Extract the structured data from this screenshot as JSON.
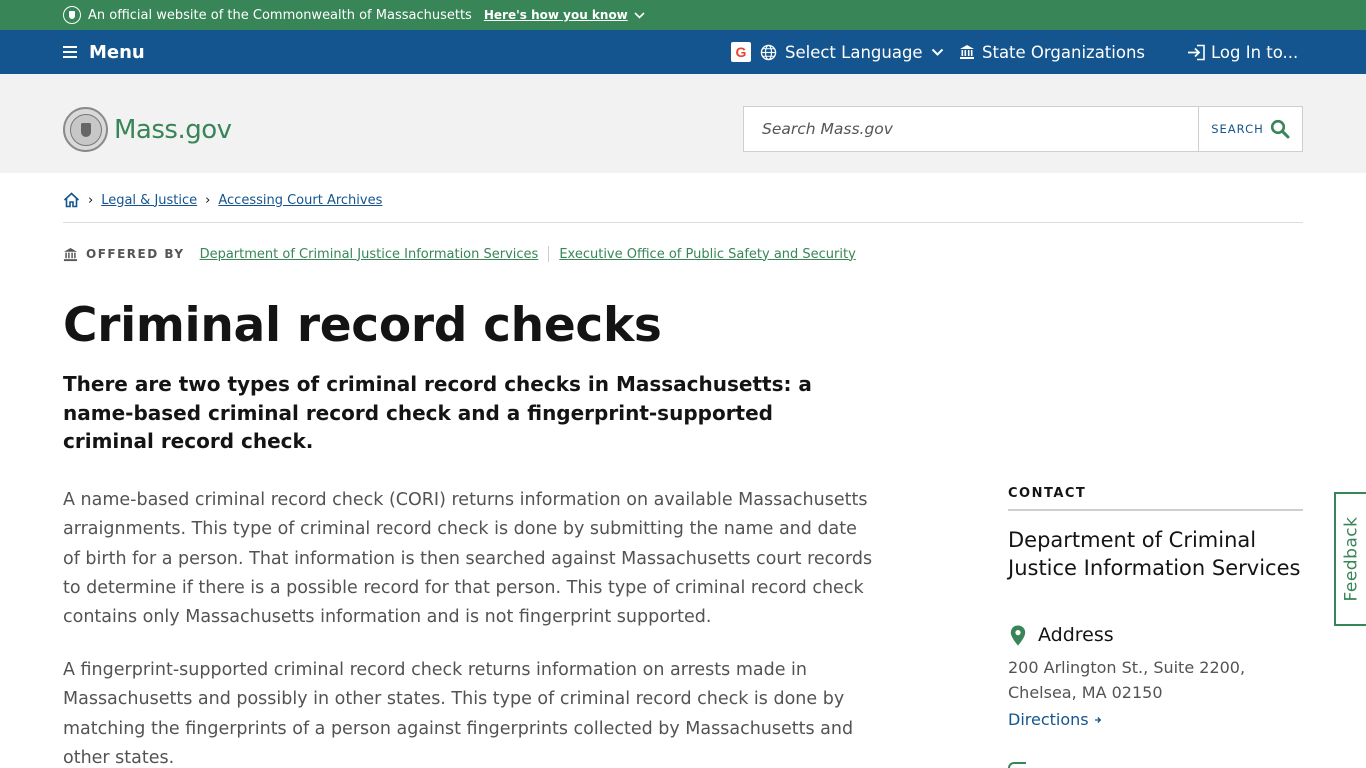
{
  "official_banner": {
    "text": "An official website of the Commonwealth of Massachusetts",
    "how_link": "Here's how you know"
  },
  "utility_nav": {
    "menu_label": "Menu",
    "language_label": "Select Language",
    "orgs_label": "State Organizations",
    "login_label": "Log In to..."
  },
  "header": {
    "logo_text": "Mass.gov",
    "search_placeholder": "Search Mass.gov",
    "search_button": "SEARCH"
  },
  "breadcrumb": {
    "items": [
      "Legal & Justice",
      "Accessing Court Archives"
    ]
  },
  "offered_by": {
    "label": "OFFERED BY",
    "orgs": [
      "Department of Criminal Justice Information Services",
      "Executive Office of Public Safety and Security"
    ]
  },
  "page": {
    "title": "Criminal record checks",
    "lede": "There are two types of criminal record checks in Massachusetts: a name-based criminal record check and a fingerprint-supported criminal record check.",
    "paragraphs": [
      "A name-based criminal record check (CORI) returns information on available Massachusetts arraignments. This type of criminal record check is done by submitting the name and date of birth for a person. That information is then searched against Massachusetts court records to determine if there is a possible record for that person. This type of criminal record check contains only Massachusetts information and is not fingerprint supported.",
      "A fingerprint-supported criminal record check returns information on arrests made in Massachusetts and possibly in other states. This type of criminal record check is done by matching the fingerprints of a person against fingerprints collected by Massachusetts and other states."
    ]
  },
  "contact": {
    "label": "CONTACT",
    "org_name": "Department of Criminal Justice Information Services",
    "address_heading": "Address",
    "address": "200 Arlington St., Suite 2200, Chelsea, MA 02150",
    "directions_link": "Directions"
  },
  "feedback_label": "Feedback",
  "colors": {
    "green": "#388557",
    "blue": "#14558f",
    "header_bg": "#f2f2f2"
  },
  "icons": [
    "seal-icon",
    "chevron-down-icon",
    "menu-icon",
    "google-icon",
    "globe-icon",
    "building-icon",
    "login-icon",
    "search-icon",
    "home-icon",
    "map-pin-icon",
    "arrow-right-icon"
  ]
}
